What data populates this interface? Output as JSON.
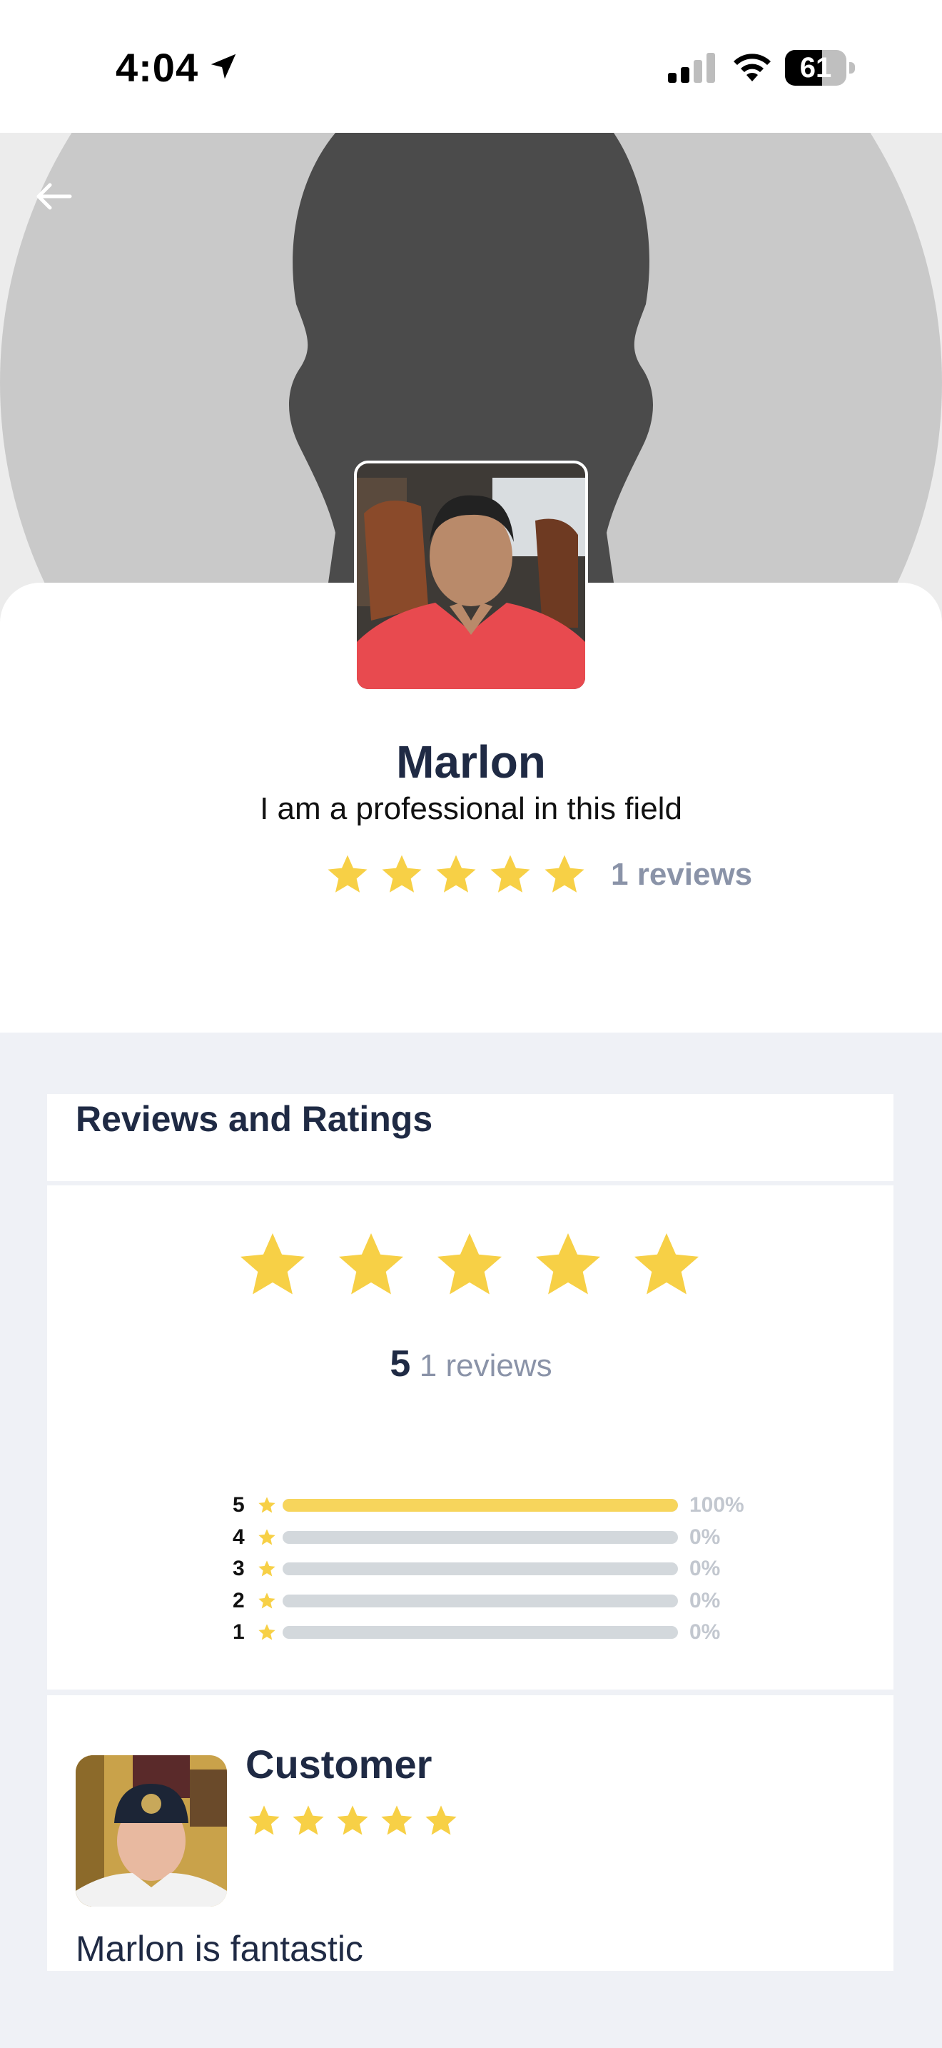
{
  "status_bar": {
    "time": "4:04",
    "battery": "61",
    "battery_level": 0.61
  },
  "icons": {
    "back": "arrow-left-icon",
    "location": "location-arrow-icon",
    "signal": "cellular-signal-icon",
    "wifi": "wifi-icon",
    "battery": "battery-icon",
    "star": "star-icon"
  },
  "colors": {
    "star": "#f7d046",
    "bar_fill": "#f7d55c",
    "bar_track": "#d3d8dc",
    "heading": "#1f2a44",
    "muted": "#8a93a8"
  },
  "profile": {
    "name": "Marlon",
    "tagline": "I am a professional in this field",
    "rating": 5,
    "reviews_label": "1 reviews"
  },
  "reviews": {
    "title": "Reviews and Ratings",
    "average": "5",
    "count_label": "1 reviews",
    "distribution": [
      {
        "stars": "5",
        "percent_label": "100%",
        "fraction": 1.0
      },
      {
        "stars": "4",
        "percent_label": "0%",
        "fraction": 0
      },
      {
        "stars": "3",
        "percent_label": "0%",
        "fraction": 0
      },
      {
        "stars": "2",
        "percent_label": "0%",
        "fraction": 0
      },
      {
        "stars": "1",
        "percent_label": "0%",
        "fraction": 0
      }
    ],
    "items": [
      {
        "author": "Customer",
        "rating": 5,
        "text": "Marlon is fantastic"
      }
    ]
  }
}
